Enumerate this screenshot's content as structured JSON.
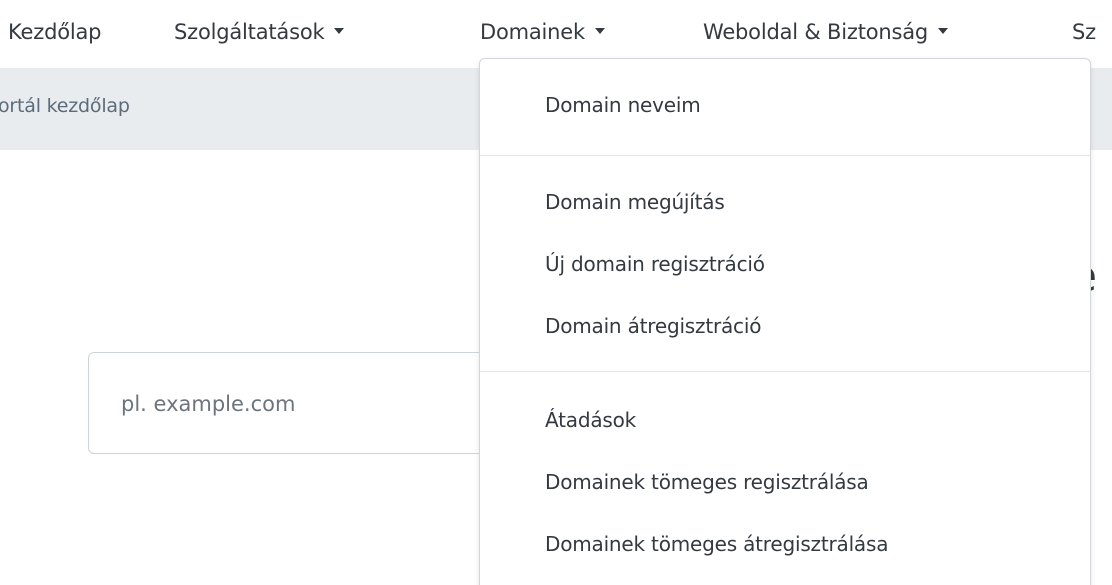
{
  "nav": {
    "items": [
      {
        "label": "Kezdőlap",
        "has_caret": false
      },
      {
        "label": "Szolgáltatások",
        "has_caret": true
      },
      {
        "label": "Domainek",
        "has_caret": true
      },
      {
        "label": "Weboldal & Biztonság",
        "has_caret": true
      },
      {
        "label": "Sz",
        "has_caret": false
      }
    ]
  },
  "breadcrumb": {
    "text": "ortál kezdőlap"
  },
  "heading": {
    "partial_text": "e"
  },
  "search": {
    "placeholder": "pl. example.com",
    "value": ""
  },
  "dropdown": {
    "groups": [
      [
        "Domain neveim"
      ],
      [
        "Domain megújítás",
        "Új domain regisztráció",
        "Domain átregisztráció"
      ],
      [
        "Átadások",
        "Domainek tömeges regisztrálása",
        "Domainek tömeges átregisztrálása"
      ]
    ]
  },
  "colors": {
    "breadcrumb_bg": "#e9ecef",
    "text": "#343a40",
    "muted_text": "#6c757d"
  }
}
